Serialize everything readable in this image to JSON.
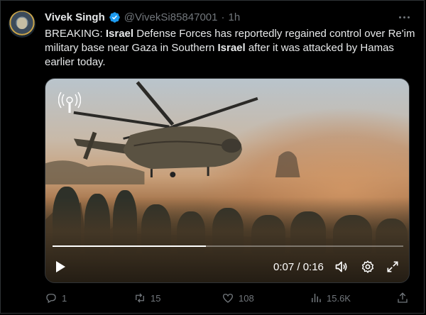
{
  "tweet": {
    "author_name": "Vivek Singh",
    "handle": "@VivekSi85847001",
    "separator": "·",
    "time": "1h",
    "text_parts": [
      {
        "text": "BREAKING: ",
        "bold": false
      },
      {
        "text": "Israel",
        "bold": true
      },
      {
        "text": " Defense Forces has reportedly regained control over Re'im military base near Gaza in Southern ",
        "bold": false
      },
      {
        "text": "Israel",
        "bold": true
      },
      {
        "text": " after it was attacked by Hamas earlier today.",
        "bold": false
      }
    ]
  },
  "video": {
    "current_time": "0:07",
    "duration": "0:16",
    "timecode": "0:07 / 0:16",
    "progress_fraction": 0.4375
  },
  "actions": {
    "replies": "1",
    "reposts": "15",
    "likes": "108",
    "views": "15.6K"
  },
  "colors": {
    "background": "#000000",
    "text": "#e7e9ea",
    "muted": "#71767b",
    "verified": "#1d9bf0"
  },
  "icons": [
    "verified-badge-icon",
    "more-icon",
    "play-icon",
    "volume-icon",
    "settings-icon",
    "fullscreen-icon",
    "reply-icon",
    "repost-icon",
    "like-icon",
    "views-icon",
    "share-icon"
  ]
}
